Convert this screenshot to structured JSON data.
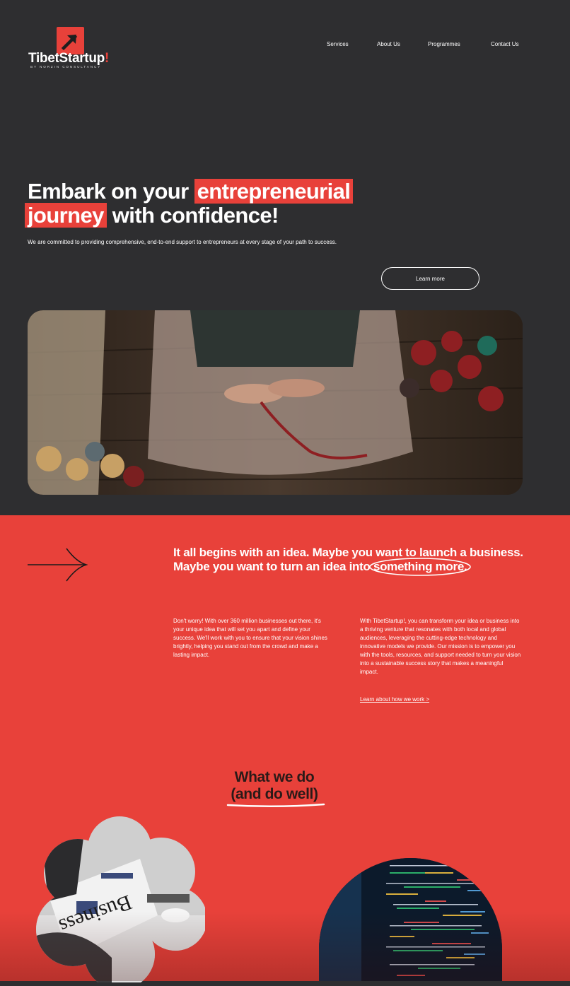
{
  "header": {
    "logo_name": "TibetStartup",
    "logo_bang": "!",
    "logo_sub": "BY NORZIN CONSULTANCY",
    "nav": [
      "Services",
      "About Us",
      "Programmes",
      "Contact Us"
    ]
  },
  "hero": {
    "line1_plain": "Embark on your",
    "line1_highlight": "entrepreneurial",
    "line2_highlight": "journey",
    "line2_plain": "with confidence!",
    "subtitle": "We are committed to providing comprehensive, end-to-end support to entrepreneurs at every stage of your path to success.",
    "cta_label": "Learn more"
  },
  "intro": {
    "heading": "It all begins with an idea. Maybe you want to launch a business. Maybe you want to turn an idea into something more.",
    "para_left": "Don't worry! With over 360 million businesses out there, it's your unique idea that will set you apart and define your success. We'll work with you to ensure that your vision shines brightly, helping you stand out from the crowd and make a lasting impact.",
    "para_right": "With TibetStartup!, you can transform your idea or business into a thriving venture that resonates with both local and global audiences, leveraging the cutting-edge technology and innovative models we provide. Our mission is to empower you with the tools, resources, and support needed to turn your vision into a sustainable success story that makes a meaningful impact.",
    "link_label": "Learn about how we work >"
  },
  "what_we_do": {
    "line1": "What we do",
    "line2": "(and do well)"
  },
  "colors": {
    "background": "#2e2e30",
    "accent": "#e8413a",
    "text": "#ffffff"
  },
  "icons": [
    "logo-arrow-icon",
    "arrow-right-icon"
  ]
}
